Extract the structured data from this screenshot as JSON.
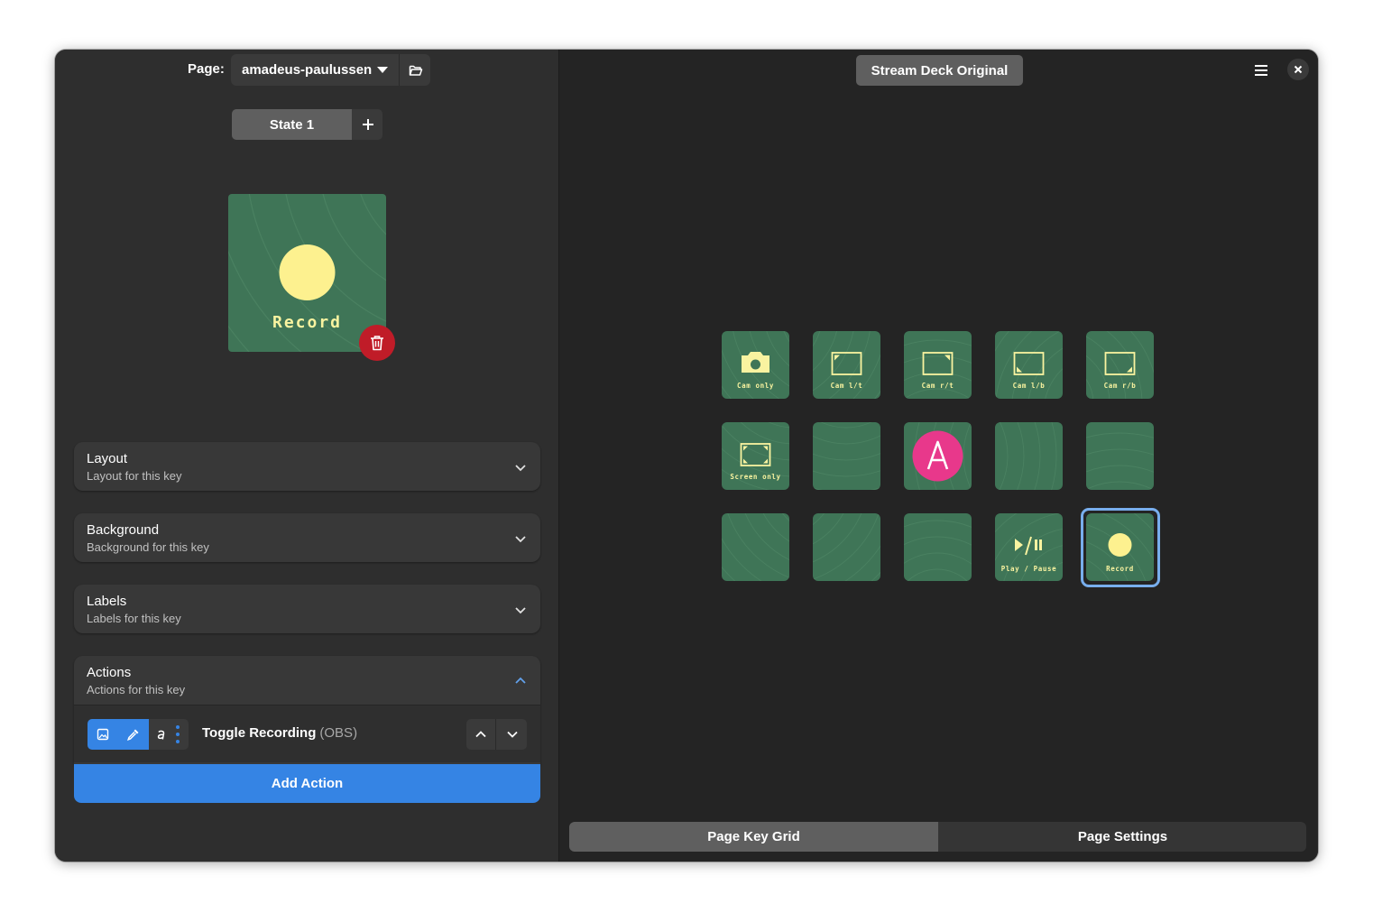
{
  "header": {
    "page_label": "Page:",
    "page_name": "amadeus-paulussen",
    "deck_name": "Stream Deck Original"
  },
  "state": {
    "tab_label": "State 1"
  },
  "preview": {
    "key_label": "Record",
    "accent_color": "#fdf18f",
    "background_color": "#3f7557"
  },
  "sections": {
    "layout": {
      "title": "Layout",
      "subtitle": "Layout for this key"
    },
    "background": {
      "title": "Background",
      "subtitle": "Background for this key"
    },
    "labels": {
      "title": "Labels",
      "subtitle": "Labels for this key"
    },
    "actions": {
      "title": "Actions",
      "subtitle": "Actions for this key"
    }
  },
  "action_item": {
    "name": "Toggle Recording",
    "source": "(OBS)"
  },
  "add_action_label": "Add Action",
  "key_grid": {
    "keys": [
      {
        "icon": "camera-icon",
        "label": "Cam only"
      },
      {
        "icon": "frame-left-top-icon",
        "label": "Cam l/t"
      },
      {
        "icon": "frame-right-top-icon",
        "label": "Cam r/t"
      },
      {
        "icon": "frame-left-bottom-icon",
        "label": "Cam l/b"
      },
      {
        "icon": "frame-right-bottom-icon",
        "label": "Cam r/b"
      },
      {
        "icon": "screen-expand-icon",
        "label": "Screen only"
      },
      {
        "icon": "",
        "label": ""
      },
      {
        "icon": "letter-a-icon",
        "label": ""
      },
      {
        "icon": "",
        "label": ""
      },
      {
        "icon": "",
        "label": ""
      },
      {
        "icon": "",
        "label": ""
      },
      {
        "icon": "",
        "label": ""
      },
      {
        "icon": "",
        "label": ""
      },
      {
        "icon": "play-pause-icon",
        "label": "Play / Pause"
      },
      {
        "icon": "record-dot-icon",
        "label": "Record"
      }
    ],
    "selected_index": 14,
    "a_icon_color": "#e8388b",
    "selection_color": "#78aeed"
  },
  "bottom_tabs": {
    "key_grid": "Page Key Grid",
    "settings": "Page Settings"
  }
}
